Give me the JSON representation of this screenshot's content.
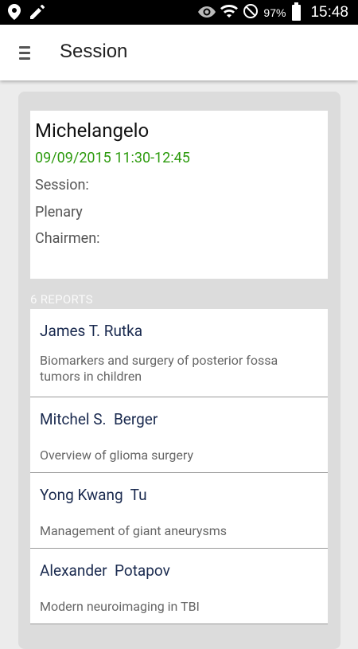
{
  "status_bar": {
    "battery_percent": "97%",
    "time": "15:48"
  },
  "appbar": {
    "title": "Session"
  },
  "session": {
    "name": "Michelangelo",
    "datetime": "09/09/2015 11:30-12:45",
    "session_label": "Session:",
    "session_value": "Plenary",
    "chairmen_label": "Chairmen:"
  },
  "reports": {
    "header": "6 REPORTS",
    "items": [
      {
        "name": "James T. Rutka",
        "topic": "Biomarkers and surgery of posterior fossa tumors in children"
      },
      {
        "name": "Mitchel S.  Berger",
        "topic": "Overview of glioma surgery"
      },
      {
        "name": "Yong Kwang  Tu",
        "topic": "Management of giant aneurysms"
      },
      {
        "name": "Alexander  Potapov",
        "topic": "Modern neuroimaging in TBI"
      }
    ]
  },
  "colors": {
    "date_green": "#2d9b0e",
    "name_navy": "#1a2a4f",
    "panel_gray": "#dcdcdc"
  }
}
